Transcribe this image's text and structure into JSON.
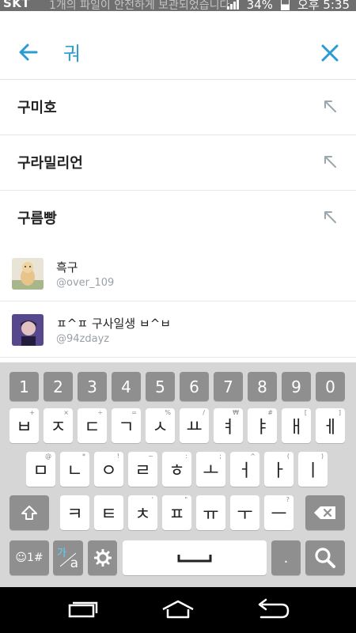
{
  "status_bar": {
    "carrier": "SKT",
    "ticker": "1개의 파일이 안전하게 보관되었습니다",
    "battery": "34%",
    "time": "오후 5:35"
  },
  "search": {
    "query": "궈"
  },
  "suggestions": [
    {
      "label": "구미호"
    },
    {
      "label": "구라밀리언"
    },
    {
      "label": "구름빵"
    }
  ],
  "users": [
    {
      "name": "흑구",
      "handle": "@over_109"
    },
    {
      "name": "ㅍ^ㅍ 구사일생 ㅂ^ㅂ",
      "handle": "@94zdayz"
    }
  ],
  "keyboard": {
    "numbers": [
      "1",
      "2",
      "3",
      "4",
      "5",
      "6",
      "7",
      "8",
      "9",
      "0"
    ],
    "row1": [
      "ㅂ",
      "ㅈ",
      "ㄷ",
      "ㄱ",
      "ㅅ",
      "ㅛ",
      "ㅕ",
      "ㅑ",
      "ㅐ",
      "ㅔ"
    ],
    "row1_hints": [
      "+",
      "×",
      "÷",
      "=",
      "%",
      "/",
      "₩",
      "#",
      "[",
      "]"
    ],
    "row2": [
      "ㅁ",
      "ㄴ",
      "ㅇ",
      "ㄹ",
      "ㅎ",
      "ㅗ",
      "ㅓ",
      "ㅏ",
      "ㅣ"
    ],
    "row2_hints": [
      "@",
      "*",
      "!",
      "~",
      ":",
      ";",
      "^",
      "(",
      ")"
    ],
    "row3": [
      "ㅋ",
      "ㅌ",
      "ㅊ",
      "ㅍ",
      "ㅠ",
      "ㅜ",
      "ㅡ"
    ],
    "row3_hints": [
      "",
      "",
      "'",
      "\"",
      "",
      "",
      "?"
    ],
    "emoji_label": "☺1#",
    "lang_label_top": "가",
    "lang_label_bottom": "a",
    "period": "."
  },
  "colors": {
    "accent": "#2b9bd3",
    "key_dark": "#8f8f8f",
    "keyboard_bg": "#d6d6d6"
  }
}
